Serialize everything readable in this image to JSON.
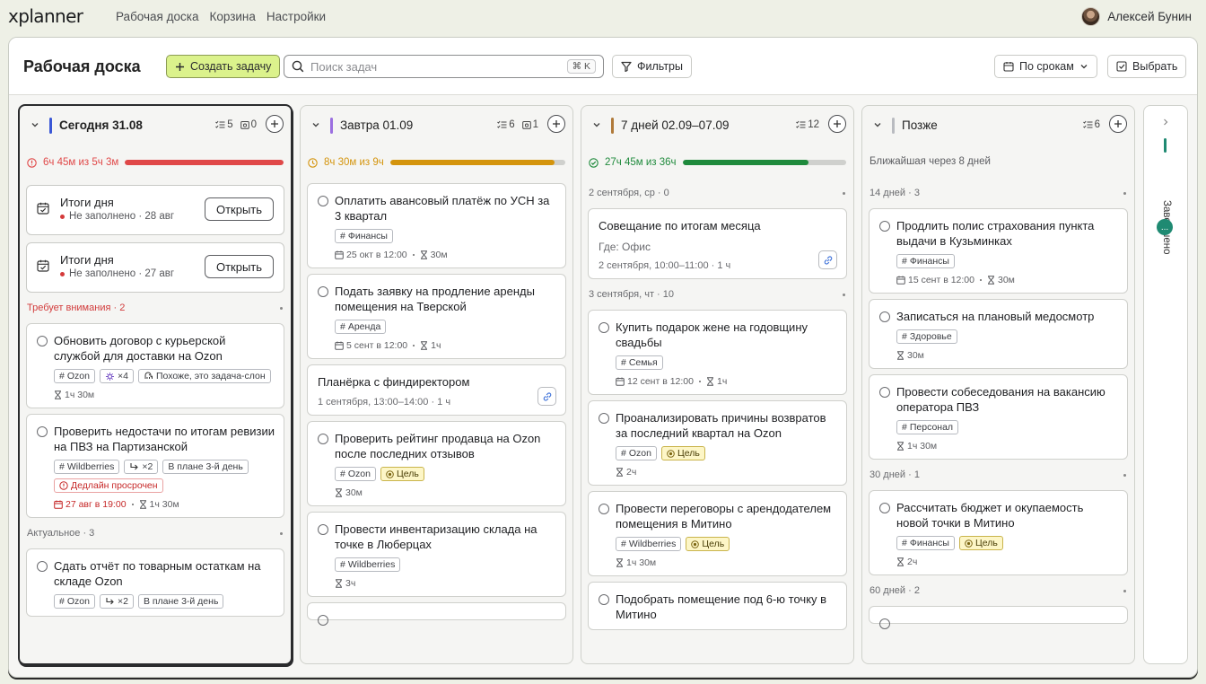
{
  "nav": {
    "logo": "xplanner",
    "links": [
      "Рабочая доска",
      "Корзина",
      "Настройки"
    ],
    "user_name": "Алексей Бунин"
  },
  "toolbar": {
    "title": "Рабочая доска",
    "create_label": "Создать задачу",
    "search_placeholder": "Поиск задач",
    "search_shortcut": "⌘ K",
    "filters_label": "Фильтры",
    "sort_label": "По срокам",
    "select_label": "Выбрать"
  },
  "colors": {
    "accent_green": "#dbf28c",
    "red": "#e04848",
    "orange": "#d4940c",
    "green": "#1f8a3c",
    "teal": "#1f8a72"
  },
  "columns": [
    {
      "title": "Сегодня 31.08",
      "bar_color": "#3a57d6",
      "tasks_count": "5",
      "events_count": "0",
      "progress_text": "6ч 45м из 5ч 3м",
      "progress_color": "#e04848",
      "progress_fraction": 1.0,
      "day_cards": [
        {
          "title": "Итоги дня",
          "status": "Не заполнено · 28 авг",
          "button": "Открыть"
        },
        {
          "title": "Итоги дня",
          "status": "Не заполнено · 27 авг",
          "button": "Открыть"
        }
      ],
      "sections": [
        {
          "label": "Требует внимания · 2",
          "red": true,
          "cards": [
            {
              "title": "Обновить договор с курьерской службой для доставки на Ozon",
              "tags": [
                {
                  "text": "Ozon",
                  "kind": "hash"
                },
                {
                  "text": "×4",
                  "kind": "sub"
                },
                {
                  "text": "Похоже, это задача-слон",
                  "kind": "elephant"
                }
              ],
              "meta": [
                {
                  "icon": "hourglass",
                  "text": "1ч 30м"
                }
              ]
            },
            {
              "title": "Проверить недостачи по итогам ревизии на ПВЗ на Партизанской",
              "tags": [
                {
                  "text": "Wildberries",
                  "kind": "hash"
                },
                {
                  "text": "×2",
                  "kind": "repeat"
                },
                {
                  "text": "В плане 3-й день",
                  "kind": "plain"
                },
                {
                  "text": "Дедлайн просрочен",
                  "kind": "overdue"
                }
              ],
              "meta": [
                {
                  "icon": "calendar",
                  "text": "27 авг в 19:00",
                  "red": true
                },
                {
                  "icon": "hourglass",
                  "text": "1ч 30м"
                }
              ]
            }
          ]
        },
        {
          "label": "Актуальное · 3",
          "cards": [
            {
              "title": "Сдать отчёт по товарным остаткам на складе Ozon",
              "tags": [
                {
                  "text": "Ozon",
                  "kind": "hash"
                },
                {
                  "text": "×2",
                  "kind": "repeat"
                },
                {
                  "text": "В плане 3-й день",
                  "kind": "plain"
                }
              ],
              "meta": []
            }
          ]
        }
      ]
    },
    {
      "title": "Завтра 01.09",
      "bar_color": "#9b6fe0",
      "tasks_count": "6",
      "events_count": "1",
      "progress_text": "8ч 30м из 9ч",
      "progress_color": "#d4940c",
      "progress_fraction": 0.94,
      "sections": [
        {
          "label": "",
          "cards": [
            {
              "title": "Оплатить авансовый платёж по УСН за 3 квартал",
              "tags": [
                {
                  "text": "Финансы",
                  "kind": "hash"
                }
              ],
              "meta": [
                {
                  "icon": "calendar",
                  "text": "25 окт в 12:00"
                },
                {
                  "icon": "hourglass",
                  "text": "30м"
                }
              ]
            },
            {
              "title": "Подать заявку на продление аренды помещения на Тверской",
              "tags": [
                {
                  "text": "Аренда",
                  "kind": "hash"
                }
              ],
              "meta": [
                {
                  "icon": "calendar",
                  "text": "5 сент в 12:00"
                },
                {
                  "icon": "hourglass",
                  "text": "1ч"
                }
              ]
            },
            {
              "event": true,
              "title": "Планёрка с финдиректором",
              "sub": "1 сентября, 13:00–14:00 · 1 ч"
            },
            {
              "title": "Проверить рейтинг продавца на Ozon после последних отзывов",
              "tags": [
                {
                  "text": "Ozon",
                  "kind": "hash"
                },
                {
                  "text": "Цель",
                  "kind": "goal"
                }
              ],
              "meta": [
                {
                  "icon": "hourglass",
                  "text": "30м"
                }
              ]
            },
            {
              "title": "Провести инвентаризацию склада на точке в Люберцах",
              "tags": [
                {
                  "text": "Wildberries",
                  "kind": "hash"
                }
              ],
              "meta": [
                {
                  "icon": "hourglass",
                  "text": "3ч"
                }
              ]
            },
            {
              "title": "",
              "tags": [],
              "meta": []
            }
          ]
        }
      ]
    },
    {
      "title": "7 дней 02.09–07.09",
      "bar_color": "#b07a3a",
      "tasks_count": "12",
      "progress_text": "27ч 45м из 36ч",
      "progress_color": "#1f8a3c",
      "progress_fraction": 0.77,
      "sections": [
        {
          "label": "2 сентября, ср · 0",
          "cards": [
            {
              "event": true,
              "title": "Совещание по итогам месяца",
              "place": "Где: Офис",
              "sub": "2 сентября, 10:00–11:00 · 1 ч"
            }
          ]
        },
        {
          "label": "3 сентября, чт · 10",
          "cards": [
            {
              "title": "Купить подарок жене на годовщину свадьбы",
              "tags": [
                {
                  "text": "Семья",
                  "kind": "hash"
                }
              ],
              "meta": [
                {
                  "icon": "calendar",
                  "text": "12 сент в 12:00"
                },
                {
                  "icon": "hourglass",
                  "text": "1ч"
                }
              ]
            },
            {
              "title": "Проанализировать причины возвратов за последний квартал на Ozon",
              "tags": [
                {
                  "text": "Ozon",
                  "kind": "hash"
                },
                {
                  "text": "Цель",
                  "kind": "goal"
                }
              ],
              "meta": [
                {
                  "icon": "hourglass",
                  "text": "2ч"
                }
              ]
            },
            {
              "title": "Провести переговоры с арендодателем помещения в Митино",
              "tags": [
                {
                  "text": "Wildberries",
                  "kind": "hash"
                },
                {
                  "text": "Цель",
                  "kind": "goal"
                }
              ],
              "meta": [
                {
                  "icon": "hourglass",
                  "text": "1ч 30м"
                }
              ]
            },
            {
              "title": "Подобрать помещение под 6-ю точку в Митино",
              "tags": [],
              "meta": []
            }
          ]
        }
      ]
    },
    {
      "title": "Позже",
      "bar_color": "#b9bbc0",
      "tasks_count": "6",
      "nearest": "Ближайшая через 8 дней",
      "sections": [
        {
          "label": "14 дней · 3",
          "cards": [
            {
              "title": "Продлить полис страхования пункта выдачи в Кузьминках",
              "tags": [
                {
                  "text": "Финансы",
                  "kind": "hash"
                }
              ],
              "meta": [
                {
                  "icon": "calendar",
                  "text": "15 сент в 12:00"
                },
                {
                  "icon": "hourglass",
                  "text": "30м"
                }
              ]
            },
            {
              "title": "Записаться на плановый медосмотр",
              "tags": [
                {
                  "text": "Здоровье",
                  "kind": "hash"
                }
              ],
              "meta": [
                {
                  "icon": "hourglass",
                  "text": "30м"
                }
              ]
            },
            {
              "title": "Провести собеседования на вакансию оператора ПВЗ",
              "tags": [
                {
                  "text": "Персонал",
                  "kind": "hash"
                }
              ],
              "meta": [
                {
                  "icon": "hourglass",
                  "text": "1ч 30м"
                }
              ]
            }
          ]
        },
        {
          "label": "30 дней · 1",
          "cards": [
            {
              "title": "Рассчитать бюджет и окупаемость новой точки в Митино",
              "tags": [
                {
                  "text": "Финансы",
                  "kind": "hash"
                },
                {
                  "text": "Цель",
                  "kind": "goal"
                }
              ],
              "meta": [
                {
                  "icon": "hourglass",
                  "text": "2ч"
                }
              ]
            }
          ]
        },
        {
          "label": "60 дней · 2",
          "cards": [
            {
              "title": "",
              "tags": [],
              "meta": []
            }
          ]
        }
      ]
    }
  ],
  "done_column": {
    "label": "Завершено",
    "badge": "..."
  }
}
